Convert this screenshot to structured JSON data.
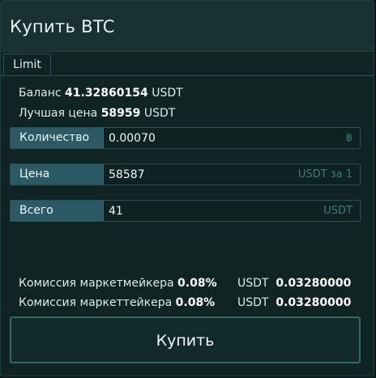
{
  "header": {
    "title": "Купить BTC"
  },
  "tabs": [
    {
      "label": "Limit"
    }
  ],
  "balance": {
    "label": "Баланс",
    "value": "41.32860154",
    "unit": "USDT"
  },
  "best_price": {
    "label": "Лучшая цена",
    "value": "58959",
    "unit": "USDT"
  },
  "form": {
    "amount": {
      "label": "Количество",
      "value": "0.00070",
      "unit": "฿"
    },
    "price": {
      "label": "Цена",
      "value": "58587",
      "unit": "USDT за 1"
    },
    "total": {
      "label": "Всего",
      "value": "41",
      "unit": "USDT"
    }
  },
  "fees": {
    "maker": {
      "label": "Комиссия маркетмейкера",
      "rate": "0.08%",
      "currency": "USDT",
      "amount": "0.03280000"
    },
    "taker": {
      "label": "Комиссия маркеттейкера",
      "rate": "0.08%",
      "currency": "USDT",
      "amount": "0.03280000"
    }
  },
  "buy_button": {
    "label": "Купить"
  },
  "colors": {
    "panel": "#102424",
    "header": "#183232",
    "field_label": "#2b5a66",
    "border": "#2f6a66"
  }
}
